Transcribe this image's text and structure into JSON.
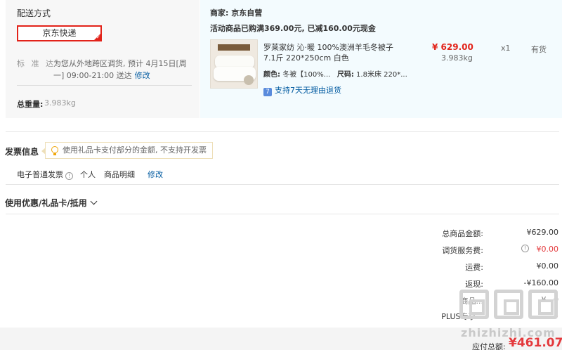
{
  "shipping": {
    "title": "配送方式",
    "method": "京东快递",
    "label": "标 准 达:",
    "info": "为您从外地跨区调货, 预计 4月15日[周一] 09:00-21:00 送达",
    "modify": "修改",
    "weight_label": "总重量:",
    "weight_value": "3.983kg"
  },
  "seller": {
    "label": "商家: 京东自营",
    "promo": "活动商品已购满369.00元, 已减160.00元现金"
  },
  "product": {
    "name": "罗莱家纺 沁·暖 100%澳洲羊毛冬被子 7.1斤 220*250cm 白色",
    "color_label": "颜色:",
    "color_value": "冬被【100%...",
    "size_label": "尺码:",
    "size_value": "1.8米床 220*...",
    "service": "支持7天无理由退货",
    "price": "¥ 629.00",
    "weight": "3.983kg",
    "qty": "x1",
    "stock": "有货"
  },
  "invoice": {
    "title": "发票信息",
    "tip": "使用礼品卡支付部分的金额, 不支持开发票",
    "type": "电子普通发票",
    "holder": "个人",
    "content": "商品明细",
    "modify": "修改"
  },
  "coupon": {
    "label": "使用优惠/礼品卡/抵用"
  },
  "summary": {
    "rows": [
      {
        "label": "总商品金额:",
        "value": "¥629.00"
      },
      {
        "label": "调货服务费:",
        "value": "¥0.00"
      },
      {
        "label": "运费:",
        "value": "¥0.00"
      },
      {
        "label": "返现:",
        "value": "-¥160.00"
      },
      {
        "label": "商品...",
        "value": "-¥...0"
      },
      {
        "label": "PLUS专享...",
        "value": "...3"
      }
    ],
    "total_label": "应付总额:",
    "total_value": "¥461.07"
  },
  "watermark": {
    "text": "zhizhizhi.com"
  },
  "colors": {
    "accent_red": "#e2231a",
    "link_blue": "#005aa0",
    "goods_bg": "#f3fbfe",
    "ship_bg": "#f7f7f7"
  }
}
